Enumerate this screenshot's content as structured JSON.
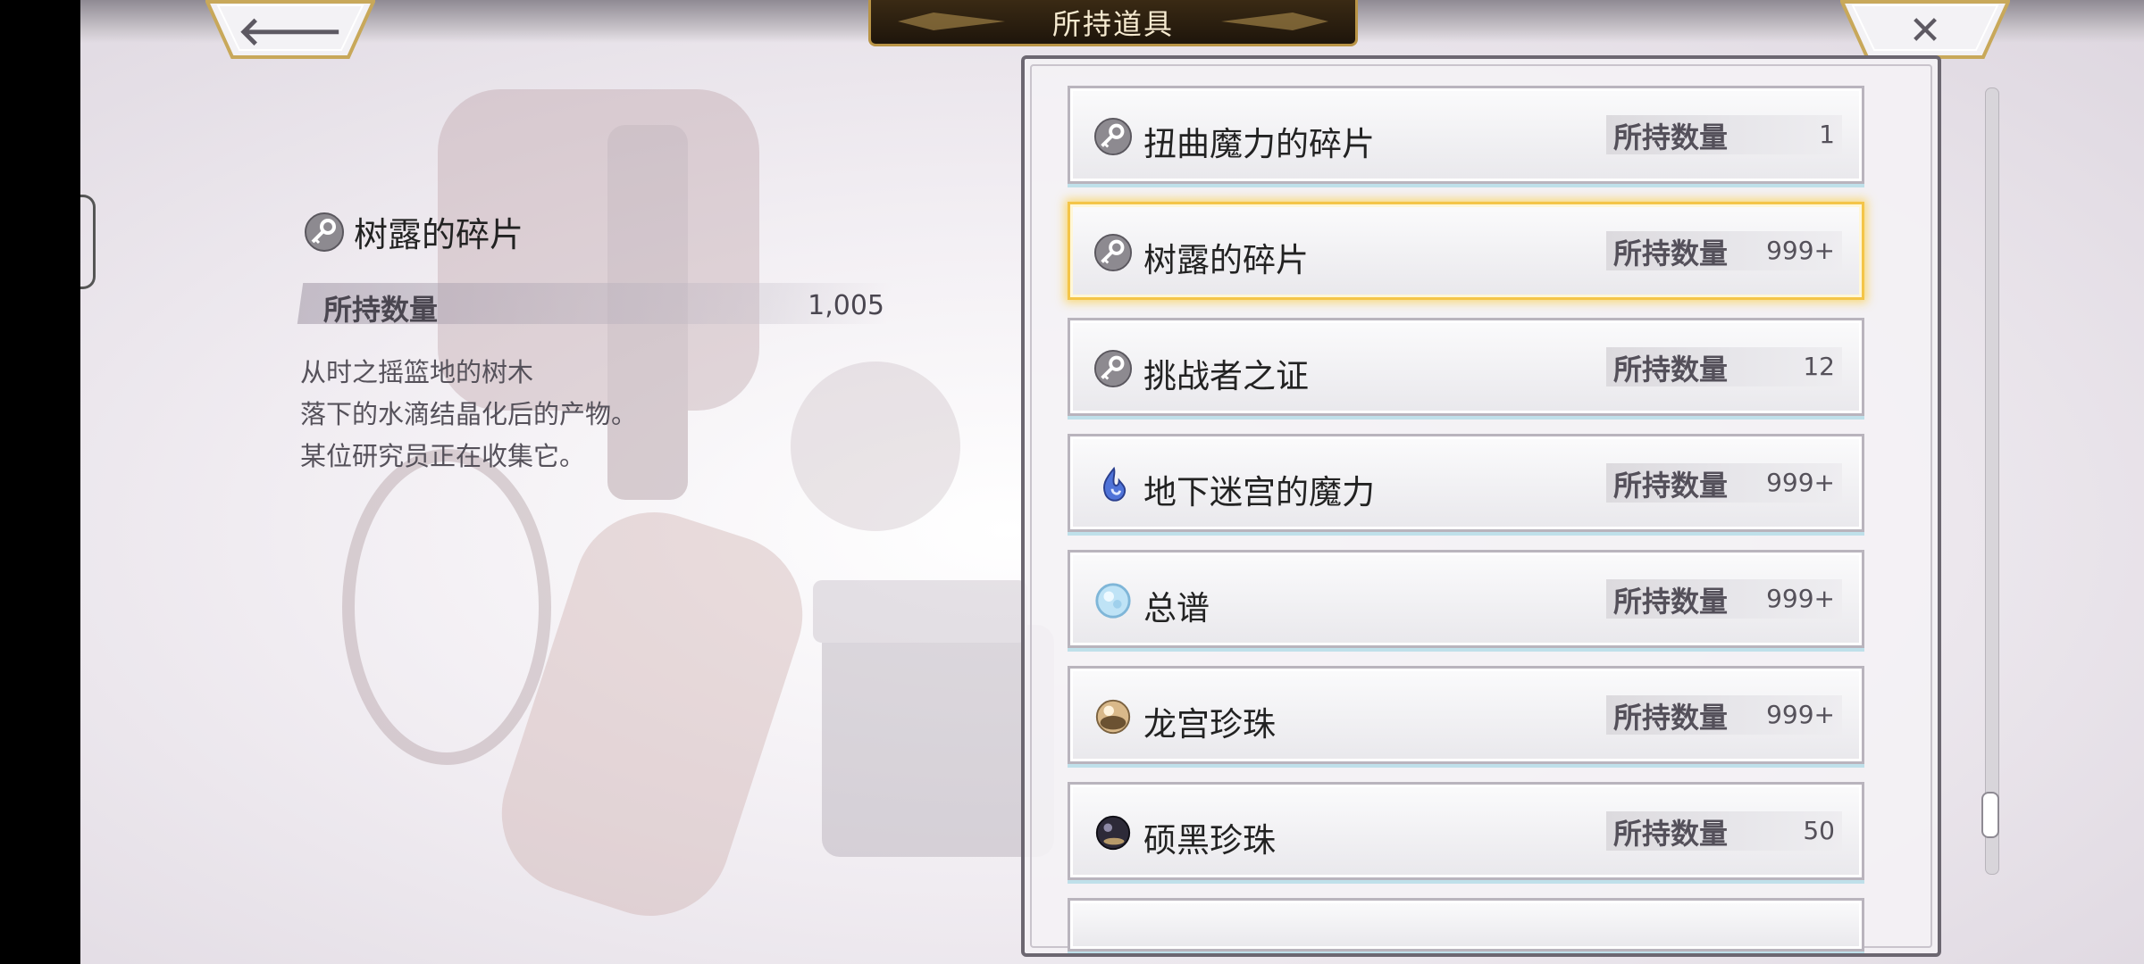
{
  "header": {
    "title": "所持道具",
    "back_icon": "arrow-left-icon",
    "close_icon": "close-x-icon"
  },
  "detail": {
    "icon": "key-fragment-icon",
    "name": "树露的碎片",
    "quantity_label": "所持数量",
    "quantity_value": "1,005",
    "description": [
      "从时之摇篮地的树木",
      "落下的水滴结晶化后的产物。",
      "某位研究员正在收集它。"
    ]
  },
  "items": [
    {
      "icon": "key-fragment-icon",
      "name": "扭曲魔力的碎片",
      "qty_label": "所持数量",
      "qty": "1",
      "selected": false
    },
    {
      "icon": "key-fragment-icon",
      "name": "树露的碎片",
      "qty_label": "所持数量",
      "qty": "999+",
      "selected": true
    },
    {
      "icon": "key-fragment-icon",
      "name": "挑战者之证",
      "qty_label": "所持数量",
      "qty": "12",
      "selected": false
    },
    {
      "icon": "blue-flame-icon",
      "name": "地下迷宫的魔力",
      "qty_label": "所持数量",
      "qty": "999+",
      "selected": false
    },
    {
      "icon": "blue-orb-icon",
      "name": "总谱",
      "qty_label": "所持数量",
      "qty": "999+",
      "selected": false
    },
    {
      "icon": "gold-pearl-icon",
      "name": "龙宫珍珠",
      "qty_label": "所持数量",
      "qty": "999+",
      "selected": false
    },
    {
      "icon": "black-pearl-icon",
      "name": "硕黑珍珠",
      "qty_label": "所持数量",
      "qty": "50",
      "selected": false
    }
  ],
  "scroll_position": 0.95
}
